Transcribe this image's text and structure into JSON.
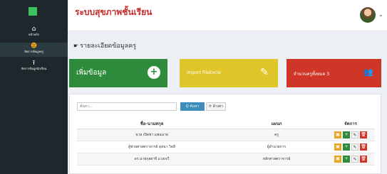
{
  "sidebar": {
    "menu_icon": "hamburger-icon",
    "items": [
      {
        "icon": "home-icon",
        "glyph": "⌂",
        "label": "หน้าหลัก"
      },
      {
        "icon": "user-icon",
        "glyph": "☻",
        "label": "จัดการข้อมูลครู"
      },
      {
        "icon": "upload-icon",
        "glyph": "⭱",
        "label": "จัดการข้อมูลนักเรียน"
      }
    ]
  },
  "header": {
    "brand": "ระบบสุขภาพชั้นเรียน",
    "caret": "⌄"
  },
  "section": {
    "icon": "☛",
    "title": "รายละเอียดข้อมูลครู"
  },
  "cards": {
    "add_label": "เพิ่มข้อมูล",
    "add_icon": "+",
    "import_label": "Import FileExcle",
    "import_icon": "✎",
    "count_label": "จำนวนครูทั้งหมด 3",
    "count_icon": "👥"
  },
  "search": {
    "placeholder": "ค้นหา...",
    "search_label": "Q ค้นหา",
    "reset_label": "⟳ ล้างค่า"
  },
  "table": {
    "headers": [
      "ชื่อ-นามสกุล",
      "แผนก",
      "จัดการ"
    ],
    "rows": [
      {
        "name": "นาย เปิดชา แพนนาย",
        "dept": "ครู"
      },
      {
        "name": "ผู้ช่วยศาสตราจารย์ ดุสนา วิลลี",
        "dept": "ผู้อำนวยการ"
      },
      {
        "name": "ดร.นายกุลยาจี แวงเจวี",
        "dept": "หลักศาสตราจารย์"
      }
    ],
    "action_glyphs": [
      "▣",
      "+",
      "✎",
      "🗑"
    ]
  }
}
